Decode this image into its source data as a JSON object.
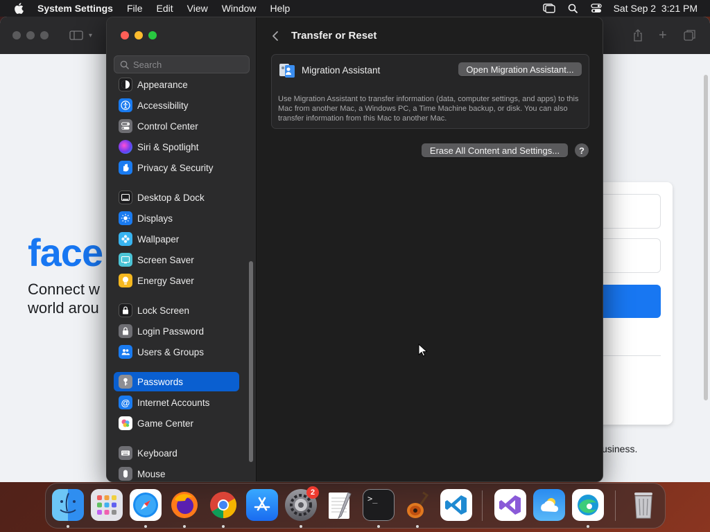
{
  "menubar": {
    "app_name": "System Settings",
    "menus": [
      "File",
      "Edit",
      "View",
      "Window",
      "Help"
    ],
    "date": "Sat Sep 2",
    "time": "3:21 PM"
  },
  "background_page": {
    "logo_text": "face",
    "tagline_line1": "Connect w",
    "tagline_line2": "world arou",
    "footer_text": "usiness."
  },
  "sidebar": {
    "search_placeholder": "Search",
    "items": [
      {
        "label": "Appearance",
        "icon": "appearance-icon",
        "color": "#1c1c1e"
      },
      {
        "label": "Accessibility",
        "icon": "accessibility-icon",
        "color": "#1a7bf0"
      },
      {
        "label": "Control Center",
        "icon": "control-center-icon",
        "color": "#6e6e73"
      },
      {
        "label": "Siri & Spotlight",
        "icon": "siri-icon",
        "color": "#c238c8"
      },
      {
        "label": "Privacy & Security",
        "icon": "hand-icon",
        "color": "#1a7bf0"
      },
      {
        "label": "Desktop & Dock",
        "icon": "dock-icon",
        "color": "#1c1c1e"
      },
      {
        "label": "Displays",
        "icon": "sun-icon",
        "color": "#1a7bf0"
      },
      {
        "label": "Wallpaper",
        "icon": "flower-icon",
        "color": "#38b4f0"
      },
      {
        "label": "Screen Saver",
        "icon": "screen-saver-icon",
        "color": "#4cc4d6"
      },
      {
        "label": "Energy Saver",
        "icon": "battery-icon",
        "color": "#f5b820"
      },
      {
        "label": "Lock Screen",
        "icon": "lock-icon",
        "color": "#1c1c1e"
      },
      {
        "label": "Login Password",
        "icon": "lock-icon",
        "color": "#6e6e73"
      },
      {
        "label": "Users & Groups",
        "icon": "users-icon",
        "color": "#1a7bf0"
      },
      {
        "label": "Passwords",
        "icon": "key-icon",
        "color": "#8e8e93"
      },
      {
        "label": "Internet Accounts",
        "icon": "at-icon",
        "color": "#1a7bf0"
      },
      {
        "label": "Game Center",
        "icon": "game-center-icon",
        "color": "#e040a0"
      },
      {
        "label": "Keyboard",
        "icon": "keyboard-icon",
        "color": "#6e6e73"
      },
      {
        "label": "Mouse",
        "icon": "mouse-icon",
        "color": "#6e6e73"
      }
    ],
    "selected": "Passwords"
  },
  "main": {
    "title": "Transfer or Reset",
    "migration": {
      "title": "Migration Assistant",
      "button": "Open Migration Assistant...",
      "description": "Use Migration Assistant to transfer information (data, computer settings, and apps) to this Mac from another Mac, a Windows PC, a Time Machine backup, or disk. You can also transfer information from this Mac to another Mac."
    },
    "erase_button": "Erase All Content and Settings...",
    "help_button": "?"
  },
  "dock": {
    "apps": [
      "Finder",
      "Launchpad",
      "Safari",
      "Firefox",
      "Chrome",
      "App Store",
      "System Settings",
      "TextEdit",
      "Terminal",
      "GarageBand",
      "Visual Studio Code",
      "Visual Studio",
      "Weather",
      "Edge",
      "Trash"
    ],
    "system_settings_badge": "2"
  },
  "colors": {
    "accent": "#0a5fd0",
    "facebook_blue": "#1877f2",
    "badge_red": "#ee3b30"
  }
}
